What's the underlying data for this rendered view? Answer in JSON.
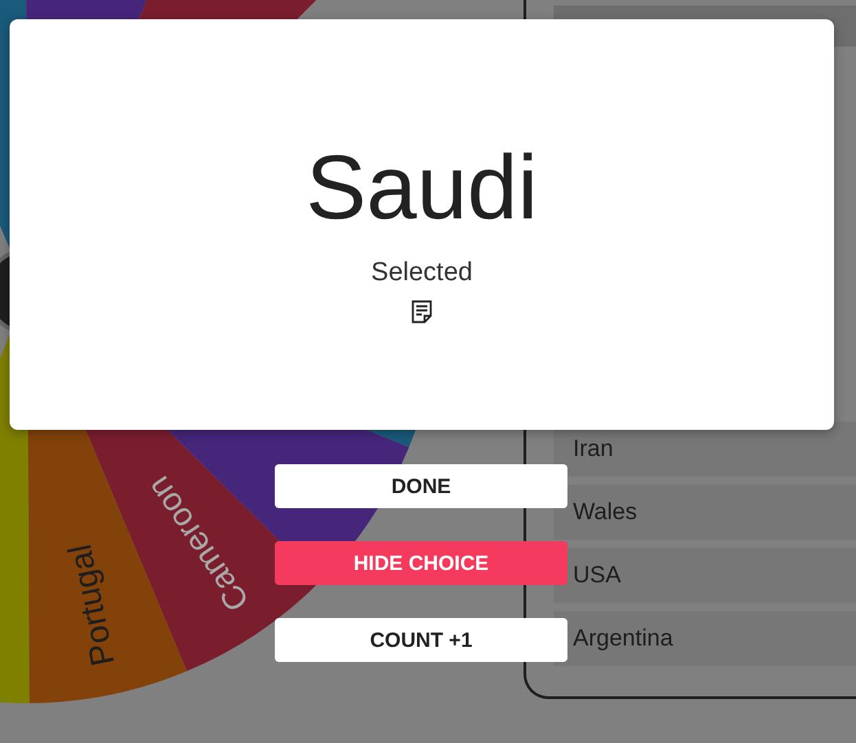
{
  "wheel": {
    "segments": [
      {
        "color": "#1a5a7a"
      },
      {
        "color": "#45267a"
      },
      {
        "color": "#7a1e2e"
      },
      {
        "color": "#1a5a7a"
      },
      {
        "color": "#45267a"
      },
      {
        "label": "Cameroon",
        "color": "#7a1e2e"
      },
      {
        "label": "Portugal",
        "color": "#82420a"
      },
      {
        "color": "#7f7f00"
      }
    ]
  },
  "results_panel": {
    "entries": [
      {
        "name": "Iran"
      },
      {
        "name": "Wales"
      },
      {
        "name": "USA"
      },
      {
        "name": "Argentina"
      }
    ]
  },
  "dialog": {
    "choice": "Saudi",
    "status": "Selected"
  },
  "buttons": [
    {
      "label": "DONE",
      "kind": "default"
    },
    {
      "label": "HIDE CHOICE",
      "kind": "danger"
    },
    {
      "label": "COUNT +1",
      "kind": "default"
    }
  ]
}
